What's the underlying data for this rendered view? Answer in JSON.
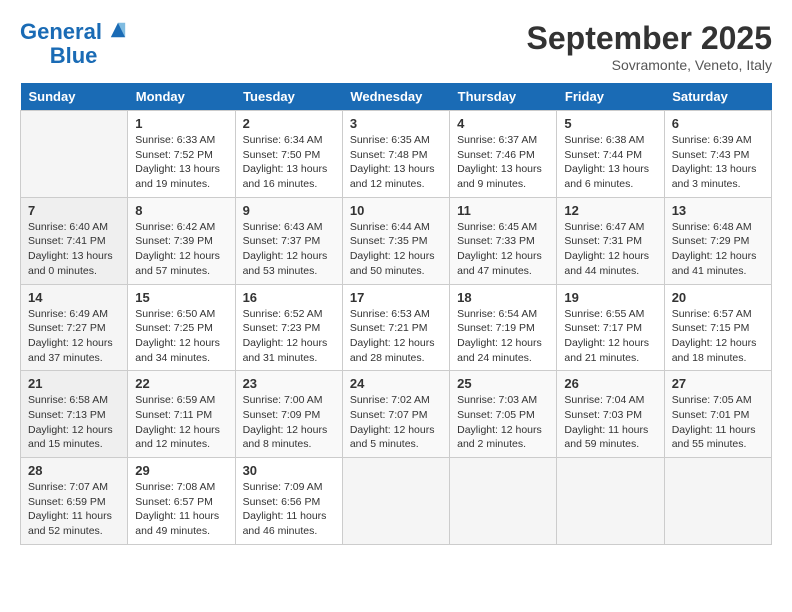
{
  "header": {
    "logo_line1": "General",
    "logo_line2": "Blue",
    "month": "September 2025",
    "location": "Sovramonte, Veneto, Italy"
  },
  "days_of_week": [
    "Sunday",
    "Monday",
    "Tuesday",
    "Wednesday",
    "Thursday",
    "Friday",
    "Saturday"
  ],
  "weeks": [
    [
      {
        "day": "",
        "info": ""
      },
      {
        "day": "1",
        "info": "Sunrise: 6:33 AM\nSunset: 7:52 PM\nDaylight: 13 hours\nand 19 minutes."
      },
      {
        "day": "2",
        "info": "Sunrise: 6:34 AM\nSunset: 7:50 PM\nDaylight: 13 hours\nand 16 minutes."
      },
      {
        "day": "3",
        "info": "Sunrise: 6:35 AM\nSunset: 7:48 PM\nDaylight: 13 hours\nand 12 minutes."
      },
      {
        "day": "4",
        "info": "Sunrise: 6:37 AM\nSunset: 7:46 PM\nDaylight: 13 hours\nand 9 minutes."
      },
      {
        "day": "5",
        "info": "Sunrise: 6:38 AM\nSunset: 7:44 PM\nDaylight: 13 hours\nand 6 minutes."
      },
      {
        "day": "6",
        "info": "Sunrise: 6:39 AM\nSunset: 7:43 PM\nDaylight: 13 hours\nand 3 minutes."
      }
    ],
    [
      {
        "day": "7",
        "info": "Sunrise: 6:40 AM\nSunset: 7:41 PM\nDaylight: 13 hours\nand 0 minutes."
      },
      {
        "day": "8",
        "info": "Sunrise: 6:42 AM\nSunset: 7:39 PM\nDaylight: 12 hours\nand 57 minutes."
      },
      {
        "day": "9",
        "info": "Sunrise: 6:43 AM\nSunset: 7:37 PM\nDaylight: 12 hours\nand 53 minutes."
      },
      {
        "day": "10",
        "info": "Sunrise: 6:44 AM\nSunset: 7:35 PM\nDaylight: 12 hours\nand 50 minutes."
      },
      {
        "day": "11",
        "info": "Sunrise: 6:45 AM\nSunset: 7:33 PM\nDaylight: 12 hours\nand 47 minutes."
      },
      {
        "day": "12",
        "info": "Sunrise: 6:47 AM\nSunset: 7:31 PM\nDaylight: 12 hours\nand 44 minutes."
      },
      {
        "day": "13",
        "info": "Sunrise: 6:48 AM\nSunset: 7:29 PM\nDaylight: 12 hours\nand 41 minutes."
      }
    ],
    [
      {
        "day": "14",
        "info": "Sunrise: 6:49 AM\nSunset: 7:27 PM\nDaylight: 12 hours\nand 37 minutes."
      },
      {
        "day": "15",
        "info": "Sunrise: 6:50 AM\nSunset: 7:25 PM\nDaylight: 12 hours\nand 34 minutes."
      },
      {
        "day": "16",
        "info": "Sunrise: 6:52 AM\nSunset: 7:23 PM\nDaylight: 12 hours\nand 31 minutes."
      },
      {
        "day": "17",
        "info": "Sunrise: 6:53 AM\nSunset: 7:21 PM\nDaylight: 12 hours\nand 28 minutes."
      },
      {
        "day": "18",
        "info": "Sunrise: 6:54 AM\nSunset: 7:19 PM\nDaylight: 12 hours\nand 24 minutes."
      },
      {
        "day": "19",
        "info": "Sunrise: 6:55 AM\nSunset: 7:17 PM\nDaylight: 12 hours\nand 21 minutes."
      },
      {
        "day": "20",
        "info": "Sunrise: 6:57 AM\nSunset: 7:15 PM\nDaylight: 12 hours\nand 18 minutes."
      }
    ],
    [
      {
        "day": "21",
        "info": "Sunrise: 6:58 AM\nSunset: 7:13 PM\nDaylight: 12 hours\nand 15 minutes."
      },
      {
        "day": "22",
        "info": "Sunrise: 6:59 AM\nSunset: 7:11 PM\nDaylight: 12 hours\nand 12 minutes."
      },
      {
        "day": "23",
        "info": "Sunrise: 7:00 AM\nSunset: 7:09 PM\nDaylight: 12 hours\nand 8 minutes."
      },
      {
        "day": "24",
        "info": "Sunrise: 7:02 AM\nSunset: 7:07 PM\nDaylight: 12 hours\nand 5 minutes."
      },
      {
        "day": "25",
        "info": "Sunrise: 7:03 AM\nSunset: 7:05 PM\nDaylight: 12 hours\nand 2 minutes."
      },
      {
        "day": "26",
        "info": "Sunrise: 7:04 AM\nSunset: 7:03 PM\nDaylight: 11 hours\nand 59 minutes."
      },
      {
        "day": "27",
        "info": "Sunrise: 7:05 AM\nSunset: 7:01 PM\nDaylight: 11 hours\nand 55 minutes."
      }
    ],
    [
      {
        "day": "28",
        "info": "Sunrise: 7:07 AM\nSunset: 6:59 PM\nDaylight: 11 hours\nand 52 minutes."
      },
      {
        "day": "29",
        "info": "Sunrise: 7:08 AM\nSunset: 6:57 PM\nDaylight: 11 hours\nand 49 minutes."
      },
      {
        "day": "30",
        "info": "Sunrise: 7:09 AM\nSunset: 6:56 PM\nDaylight: 11 hours\nand 46 minutes."
      },
      {
        "day": "",
        "info": ""
      },
      {
        "day": "",
        "info": ""
      },
      {
        "day": "",
        "info": ""
      },
      {
        "day": "",
        "info": ""
      }
    ]
  ]
}
